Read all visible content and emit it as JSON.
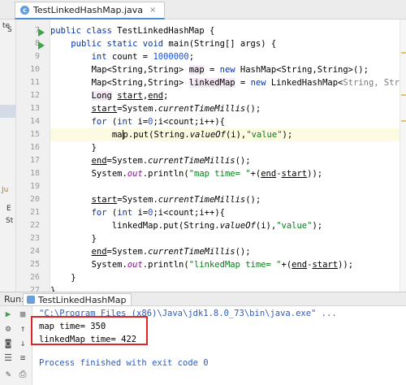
{
  "editor": {
    "tab_label": "TestLinkedHashMap.java",
    "tab_close": "×"
  },
  "gutter": {
    "line_numbers": [
      "7",
      "8",
      "9",
      "10",
      "11",
      "12",
      "13",
      "14",
      "15",
      "16",
      "17",
      "18",
      "19",
      "20",
      "21",
      "22",
      "23",
      "24",
      "25",
      "26",
      "27",
      "28",
      "29"
    ]
  },
  "left_panel": {
    "fragments": [
      "te",
      "Ju",
      "E",
      "St",
      "S"
    ]
  },
  "code_lines": [
    "public class TestLinkedHashMap {",
    "    public static void main(String[] args) {",
    "        int count = 1000000;",
    "        Map<String,String> map = new HashMap<String,String>();",
    "        Map<String,String> linkedMap = new LinkedHashMap<String, String>();",
    "        Long start,end;",
    "        start=System.currentTimeMillis();",
    "        for (int i=0;i<count;i++){",
    "            map.put(String.valueOf(i),\"value\");",
    "        }",
    "        end=System.currentTimeMillis();",
    "        System.out.println(\"map time= \"+(end-start));",
    "",
    "        start=System.currentTimeMillis();",
    "        for (int i=0;i<count;i++){",
    "            linkedMap.put(String.valueOf(i),\"value\");",
    "        }",
    "        end=System.currentTimeMillis();",
    "        System.out.println(\"linkedMap time= \"+(end-start));",
    "    }",
    "}",
    "",
    ""
  ],
  "run_window": {
    "label": "Run:",
    "tab_label": "TestLinkedHashMap",
    "command": "\"C:\\Program Files (x86)\\Java\\jdk1.8.0_73\\bin\\java.exe\" ...",
    "output": [
      "map time= 350",
      "linkedMap time= 422"
    ],
    "finish": "Process finished with exit code 0"
  },
  "colors": {
    "keyword": "#0033b3",
    "string": "#067d17",
    "number": "#1750eb",
    "field": "#871094",
    "highlight_box": "#e02424",
    "run_icon": "#3ea54a"
  }
}
